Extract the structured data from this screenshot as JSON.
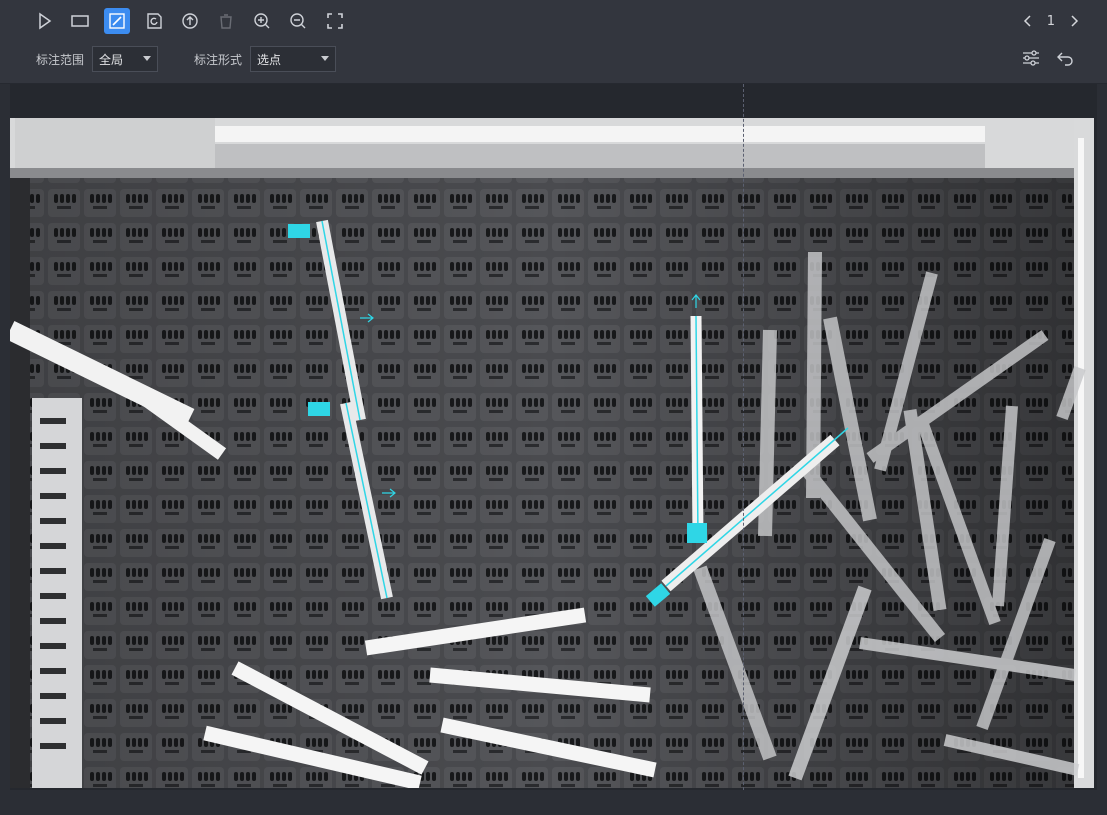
{
  "toolbar": {
    "tools": [
      {
        "icon": "pointer-icon",
        "state": "normal"
      },
      {
        "icon": "rectangle-icon",
        "state": "normal"
      },
      {
        "icon": "edit-icon",
        "state": "active"
      },
      {
        "icon": "export-icon",
        "state": "normal"
      },
      {
        "icon": "upload-icon",
        "state": "normal"
      },
      {
        "icon": "trash-icon",
        "state": "disabled"
      },
      {
        "icon": "zoom-in-icon",
        "state": "normal"
      },
      {
        "icon": "zoom-out-icon",
        "state": "normal"
      },
      {
        "icon": "fullscreen-icon",
        "state": "normal"
      }
    ],
    "page_number": "1",
    "scope_label": "标注范围",
    "scope_value": "全局",
    "form_label": "标注形式",
    "form_value": "选点",
    "right_icons": [
      "settings-sliders-icon",
      "undo-icon"
    ]
  },
  "colors": {
    "toolbar_bg": "#33363e",
    "accent": "#3c8cf0",
    "annotation": "#2fd6e6"
  }
}
